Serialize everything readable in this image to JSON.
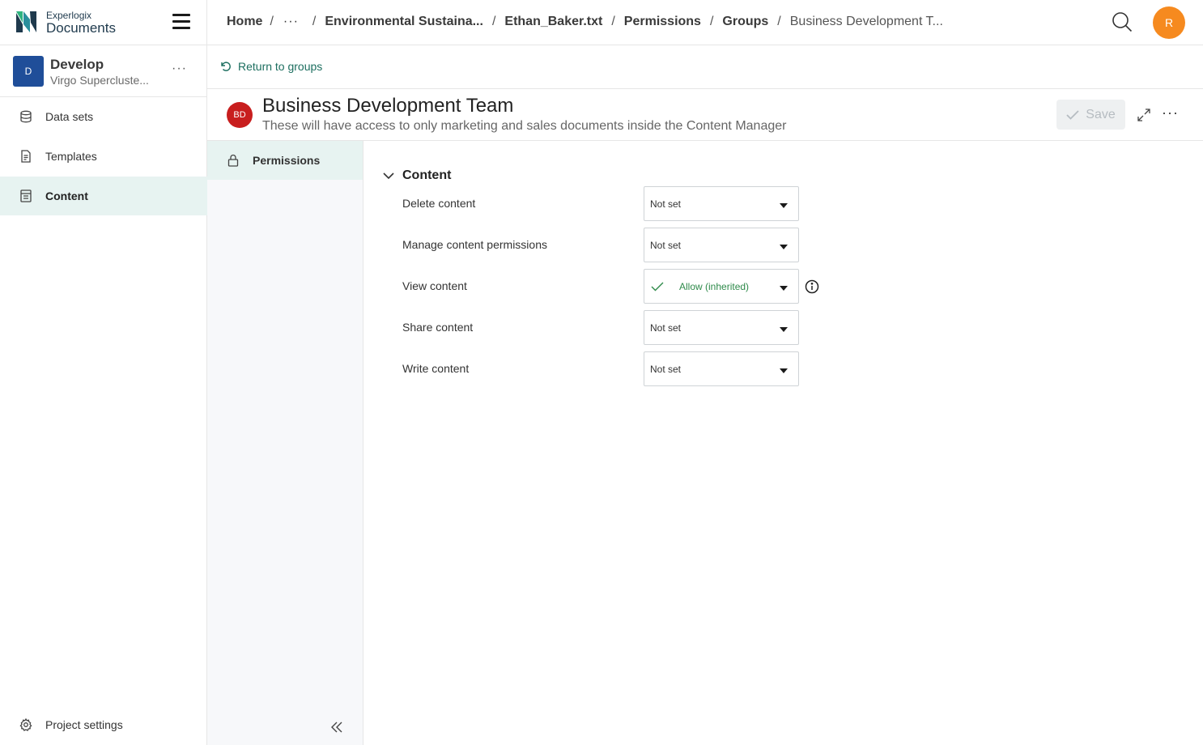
{
  "app": {
    "brand_small": "Experlogix",
    "brand_big": "Documents"
  },
  "project": {
    "avatar_letter": "D",
    "name": "Develop",
    "subtitle": "Virgo Supercluste...",
    "more_label": "···"
  },
  "sidebar": {
    "items": [
      {
        "label": "Data sets",
        "icon": "database-icon",
        "active": false
      },
      {
        "label": "Templates",
        "icon": "document-icon",
        "active": false
      },
      {
        "label": "Content",
        "icon": "content-icon",
        "active": true
      }
    ],
    "settings_label": "Project settings"
  },
  "breadcrumb": {
    "home": "Home",
    "separator": "/",
    "ellipsis": "···",
    "items": [
      "Environmental Sustaina...",
      "Ethan_Baker.txt",
      "Permissions",
      "Groups"
    ],
    "current": "Business Development T..."
  },
  "user": {
    "avatar_letter": "R",
    "avatar_color": "#f68a1f"
  },
  "return_link": "Return to groups",
  "group": {
    "avatar_initials": "BD",
    "avatar_color": "#c81e1e",
    "title": "Business Development Team",
    "description": "These will have access to only marketing and sales documents inside the Content Manager"
  },
  "toolbar": {
    "save_label": "Save",
    "more_label": "···"
  },
  "subnav": {
    "items": [
      {
        "label": "Permissions",
        "icon": "lock-icon",
        "active": true
      }
    ]
  },
  "permissions": {
    "section_title": "Content",
    "rows": [
      {
        "label": "Delete content",
        "value": "Not set"
      },
      {
        "label": "Manage content permissions",
        "value": "Not set"
      },
      {
        "label": "View content",
        "value": "Allow (inherited)"
      },
      {
        "label": "Share content",
        "value": "Not set"
      },
      {
        "label": "Write content",
        "value": "Not set"
      }
    ]
  },
  "colors": {
    "accent_green": "#1c6e5f",
    "active_bg": "#e7f3f1",
    "allow_text": "#2e8a4a"
  }
}
